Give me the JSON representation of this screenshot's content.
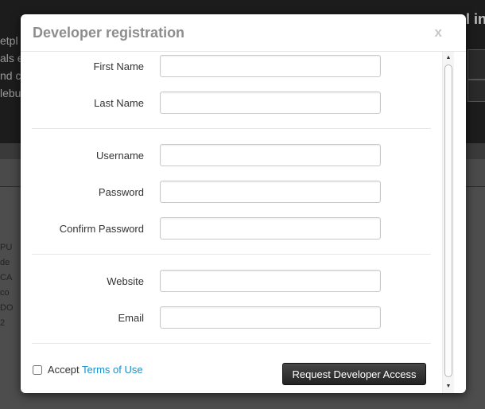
{
  "modal": {
    "title": "Developer registration",
    "close_label": "x"
  },
  "form": {
    "first_name": {
      "label": "First Name",
      "value": ""
    },
    "last_name": {
      "label": "Last Name",
      "value": ""
    },
    "username": {
      "label": "Username",
      "value": ""
    },
    "password": {
      "label": "Password",
      "value": ""
    },
    "confirm_password": {
      "label": "Confirm Password",
      "value": ""
    },
    "website": {
      "label": "Website",
      "value": ""
    },
    "email": {
      "label": "Email",
      "value": ""
    }
  },
  "footer": {
    "accept_label": "Accept",
    "terms_link": "Terms of Use",
    "accepted": false,
    "submit_label": "Request Developer Access"
  },
  "colors": {
    "link": "#1d8fc7",
    "button": "#2a2a2a",
    "title": "#8d8d8d"
  },
  "background": {
    "heading_fragment": "l in",
    "text_lines": [
      "etpl",
      "als e",
      "nd c",
      "lebu"
    ],
    "list_lines": [
      "PU",
      "de",
      "CA",
      "co",
      "DO",
      "2"
    ]
  }
}
